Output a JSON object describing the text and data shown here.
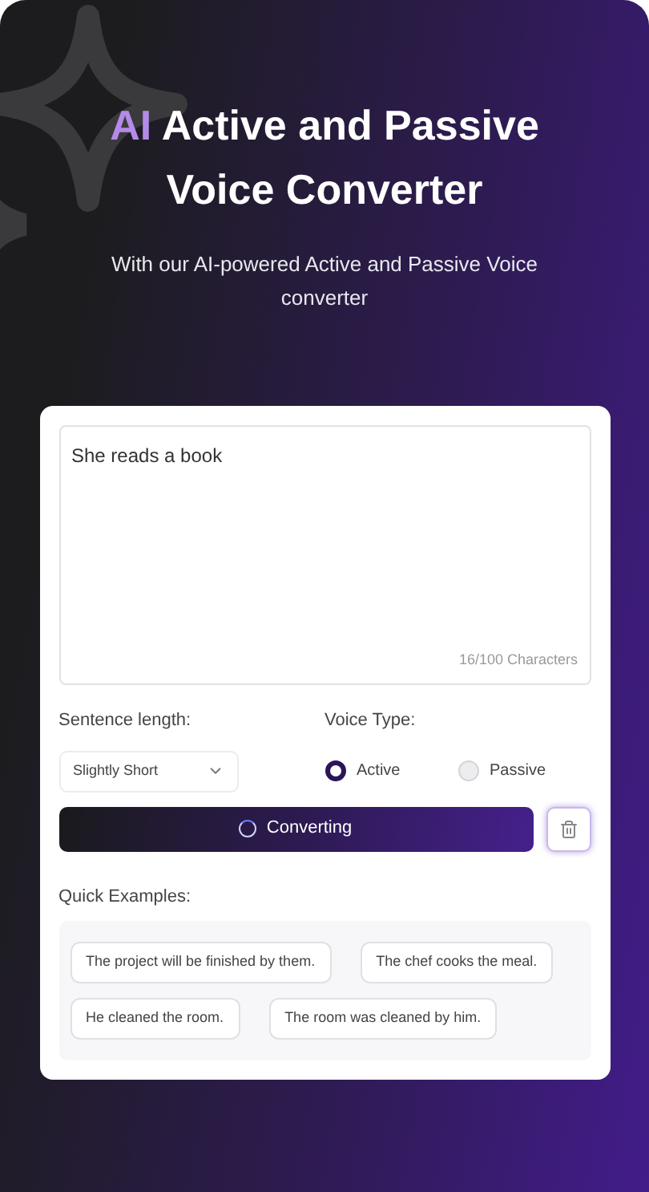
{
  "header": {
    "title_highlight": "AI",
    "title": "Active and Passive Voice Converter",
    "subtitle": "With our AI-powered Active and Passive Voice converter"
  },
  "editor": {
    "value": "She reads a book",
    "counter": "16/100 Characters"
  },
  "sentence_length": {
    "label": "Sentence length:",
    "value": "Slightly Short"
  },
  "voice_type": {
    "label": "Voice Type:",
    "options": [
      {
        "label": "Active",
        "selected": true
      },
      {
        "label": "Passive",
        "selected": false
      }
    ]
  },
  "convert_button": {
    "label": "Converting",
    "loading": true
  },
  "quick_examples": {
    "label": "Quick Examples:",
    "items": [
      "The project will be finished by them.",
      "The chef cooks the meal.",
      "He cleaned the room.",
      "The room was cleaned by him."
    ]
  }
}
